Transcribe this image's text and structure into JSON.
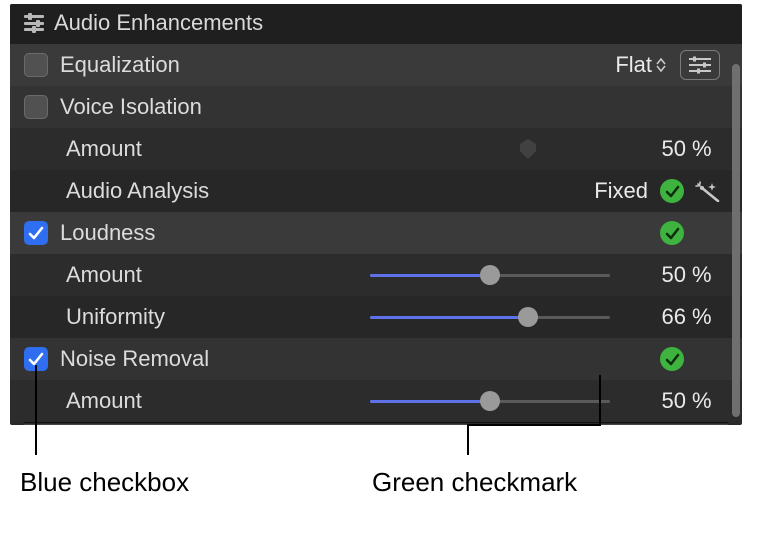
{
  "section": {
    "title": "Audio Enhancements"
  },
  "equalization": {
    "label": "Equalization",
    "checked": false,
    "preset": "Flat"
  },
  "voice_isolation": {
    "label": "Voice Isolation",
    "checked": false,
    "amount": {
      "label": "Amount",
      "value": "50",
      "unit": "%"
    },
    "analysis": {
      "label": "Audio Analysis",
      "status": "Fixed"
    }
  },
  "loudness": {
    "label": "Loudness",
    "checked": true,
    "amount": {
      "label": "Amount",
      "value": "50",
      "unit": "%",
      "percent": 50
    },
    "uniformity": {
      "label": "Uniformity",
      "value": "66",
      "unit": "%",
      "percent": 66
    }
  },
  "noise_removal": {
    "label": "Noise Removal",
    "checked": true,
    "amount": {
      "label": "Amount",
      "value": "50",
      "unit": "%",
      "percent": 50
    }
  },
  "callouts": {
    "blue_checkbox": "Blue checkbox",
    "green_checkmark": "Green checkmark"
  }
}
